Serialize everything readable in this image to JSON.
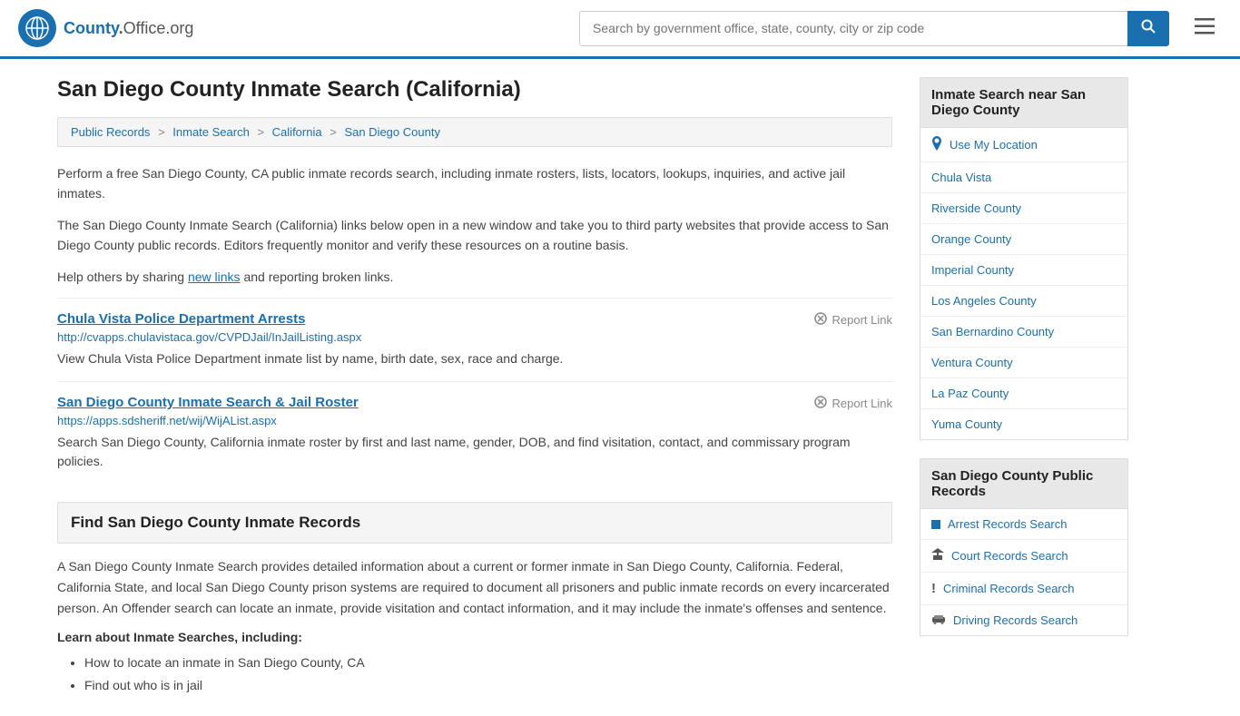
{
  "header": {
    "logo_text": "County",
    "logo_tld": "Office.org",
    "logo_icon": "🌐",
    "search_placeholder": "Search by government office, state, county, city or zip code",
    "search_btn_icon": "🔍",
    "menu_icon": "☰"
  },
  "page": {
    "title": "San Diego County Inmate Search (California)",
    "breadcrumb": [
      {
        "label": "Public Records",
        "href": "#"
      },
      {
        "label": "Inmate Search",
        "href": "#"
      },
      {
        "label": "California",
        "href": "#"
      },
      {
        "label": "San Diego County",
        "href": "#"
      }
    ],
    "description1": "Perform a free San Diego County, CA public inmate records search, including inmate rosters, lists, locators, lookups, inquiries, and active jail inmates.",
    "description2": "The San Diego County Inmate Search (California) links below open in a new window and take you to third party websites that provide access to San Diego County public records. Editors frequently monitor and verify these resources on a routine basis.",
    "description3_prefix": "Help others by sharing ",
    "description3_link": "new links",
    "description3_suffix": " and reporting broken links.",
    "links": [
      {
        "title": "Chula Vista Police Department Arrests",
        "url": "http://cvapps.chulavistaca.gov/CVPDJail/InJailListing.aspx",
        "description": "View Chula Vista Police Department inmate list by name, birth date, sex, race and charge.",
        "report_label": "Report Link"
      },
      {
        "title": "San Diego County Inmate Search & Jail Roster",
        "url": "https://apps.sdsheriff.net/wij/WijAList.aspx",
        "description": "Search San Diego County, California inmate roster by first and last name, gender, DOB, and find visitation, contact, and commissary program policies.",
        "report_label": "Report Link"
      }
    ],
    "find_section_title": "Find San Diego County Inmate Records",
    "body_text": "A San Diego County Inmate Search provides detailed information about a current or former inmate in San Diego County, California. Federal, California State, and local San Diego County prison systems are required to document all prisoners and public inmate records on every incarcerated person. An Offender search can locate an inmate, provide visitation and contact information, and it may include the inmate's offenses and sentence.",
    "learn_heading": "Learn about Inmate Searches, including:",
    "learn_items": [
      "How to locate an inmate in San Diego County, CA",
      "Find out who is in jail"
    ]
  },
  "sidebar": {
    "nearby_title": "Inmate Search near San Diego County",
    "nearby_items": [
      {
        "label": "Use My Location",
        "icon": "pin"
      },
      {
        "label": "Chula Vista",
        "icon": "link"
      },
      {
        "label": "Riverside County",
        "icon": "link"
      },
      {
        "label": "Orange County",
        "icon": "link"
      },
      {
        "label": "Imperial County",
        "icon": "link"
      },
      {
        "label": "Los Angeles County",
        "icon": "link"
      },
      {
        "label": "San Bernardino County",
        "icon": "link"
      },
      {
        "label": "Ventura County",
        "icon": "link"
      },
      {
        "label": "La Paz County",
        "icon": "link"
      },
      {
        "label": "Yuma County",
        "icon": "link"
      }
    ],
    "public_records_title": "San Diego County Public Records",
    "public_records_items": [
      {
        "label": "Arrest Records Search",
        "icon": "sq"
      },
      {
        "label": "Court Records Search",
        "icon": "building"
      },
      {
        "label": "Criminal Records Search",
        "icon": "excl"
      },
      {
        "label": "Driving Records Search",
        "icon": "car"
      }
    ]
  }
}
